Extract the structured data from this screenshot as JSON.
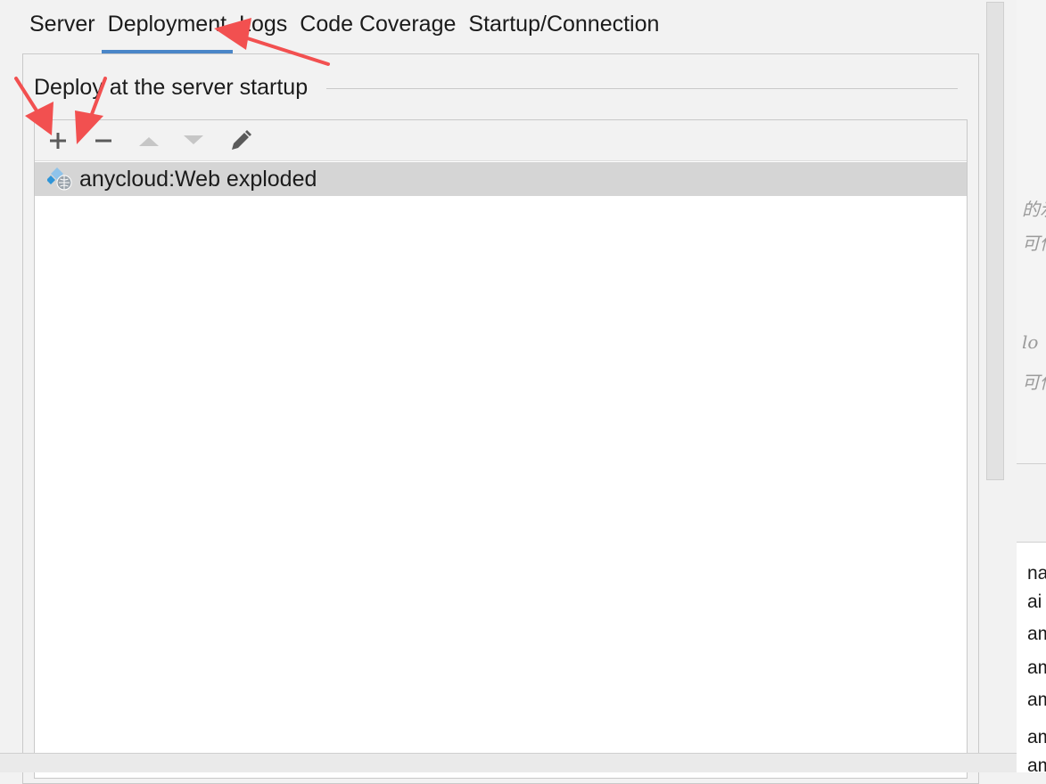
{
  "tabs": [
    {
      "label": "Server"
    },
    {
      "label": "Deployment"
    },
    {
      "label": "Logs"
    },
    {
      "label": "Code Coverage"
    },
    {
      "label": "Startup/Connection"
    }
  ],
  "active_tab": "Deployment",
  "group": {
    "title": "Deploy at the server startup"
  },
  "toolbar": {
    "add": "add-icon",
    "remove": "remove-icon",
    "move_up": "arrow-up-icon",
    "move_down": "arrow-down-icon",
    "edit": "pencil-icon"
  },
  "artifacts": [
    {
      "label": "anycloud:Web exploded",
      "icon": "web-artifact-icon",
      "selected": true
    }
  ],
  "colors": {
    "accent": "#4a86c8",
    "annotation": "#f25050",
    "selection": "#d5d5d5"
  },
  "background": {
    "editor_fragments": [
      "的示",
      "可传",
      "lo",
      "可传"
    ],
    "log_fragments": [
      "na",
      "ai",
      "am",
      "am",
      "am",
      "am",
      "am",
      "am"
    ]
  }
}
